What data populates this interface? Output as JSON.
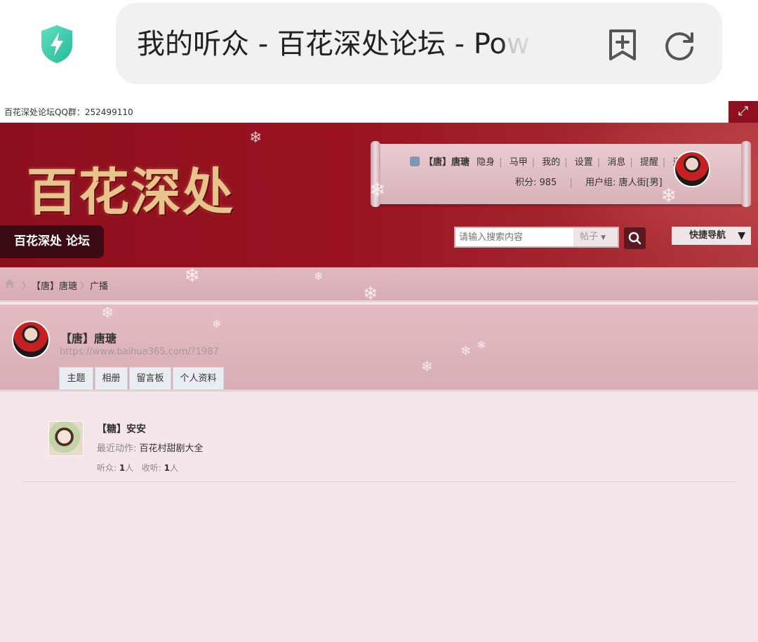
{
  "browser": {
    "title": "我的听众 - 百花深处论坛 - Po",
    "title_suffix": "w"
  },
  "topbar": {
    "qq_text": "百花深处论坛QQ群：252499110"
  },
  "header": {
    "logo": "百花深处",
    "user": {
      "name": "【唐】唐瑭",
      "links": [
        "隐身",
        "马甲",
        "我的",
        "设置",
        "消息",
        "提醒",
        "退出"
      ],
      "points_label": "积分: 985",
      "group_label": "用户组: 唐人街[男]"
    },
    "forum_tab": "百花深处 论坛",
    "search": {
      "placeholder": "请输入搜索内容",
      "type": "帖子"
    },
    "quick_nav": "快捷导航"
  },
  "breadcrumb": [
    "【唐】唐瑭",
    "广播"
  ],
  "profile": {
    "name": "【唐】唐瑭",
    "url": "https://www.baihua365.com/?1987",
    "tabs": [
      "主题",
      "相册",
      "留言板",
      "个人资料"
    ]
  },
  "listeners": [
    {
      "name": "【糖】安安",
      "recent_label": "最近动作:",
      "recent_value": "百花村甜剧大全",
      "listeners_label": "听众:",
      "listeners_count": "1",
      "following_label": "收听:",
      "following_count": "1",
      "unit": "人"
    }
  ],
  "colors": {
    "header_red": "#8c0f1d",
    "band_pink": "#dfb5bb",
    "content_bg": "#f4e6e9"
  }
}
